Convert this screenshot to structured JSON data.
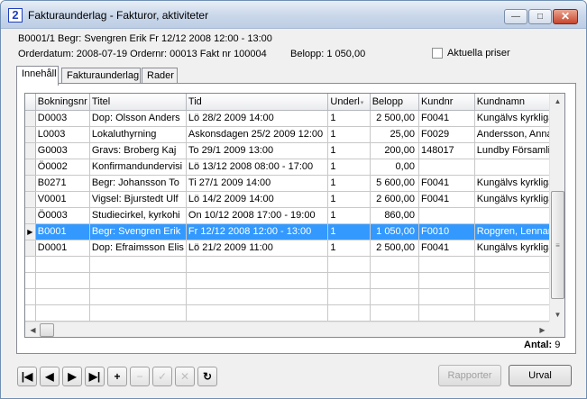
{
  "window": {
    "app_icon": "2",
    "title": "Fakturaunderlag - Fakturor, aktiviteter",
    "controls": {
      "minimize": "—",
      "maximize": "□",
      "close": "✕"
    }
  },
  "info": {
    "line1": "B0001/1  Begr: Svengren Erik  Fr 12/12 2008 12:00 - 13:00",
    "orderdatum": "Orderdatum: 2008-07-19 Ordernr: 00013 Fakt nr 100004",
    "belopp": "Belopp:  1 050,00",
    "aktuella_priser": "Aktuella priser"
  },
  "tabs": [
    {
      "label": "Innehåll"
    },
    {
      "label": "Fakturaunderlag"
    },
    {
      "label": "Rader"
    }
  ],
  "table": {
    "columns": [
      "Bokningsnr",
      "Titel",
      "Tid",
      "Underl",
      "Belopp",
      "Kundnr",
      "Kundnamn"
    ],
    "rows": [
      {
        "bokningsnr": "D0003",
        "titel": "Dop: Olsson Anders",
        "tid": "Lö 28/2 2009 14:00",
        "underl": "1",
        "belopp": "2 500,00",
        "kundnr": "F0041",
        "kundnamn": "Kungälvs kyrkliga s"
      },
      {
        "bokningsnr": "L0003",
        "titel": "Lokaluthyrning",
        "tid": "Askonsdagen 25/2 2009 12:00",
        "underl": "1",
        "belopp": "25,00",
        "kundnr": "F0029",
        "kundnamn": "Andersson, Anna"
      },
      {
        "bokningsnr": "G0003",
        "titel": "Gravs: Broberg Kaj",
        "tid": "To 29/1 2009 13:00",
        "underl": "1",
        "belopp": "200,00",
        "kundnr": "148017",
        "kundnamn": "Lundby Församling"
      },
      {
        "bokningsnr": "Ö0002",
        "titel": "Konfirmandundervisi",
        "tid": "Lö 13/12 2008 08:00 - 17:00",
        "underl": "1",
        "belopp": "0,00",
        "kundnr": "",
        "kundnamn": ""
      },
      {
        "bokningsnr": "B0271",
        "titel": "Begr: Johansson To",
        "tid": "Ti 27/1 2009 14:00",
        "underl": "1",
        "belopp": "5 600,00",
        "kundnr": "F0041",
        "kundnamn": "Kungälvs kyrkliga s"
      },
      {
        "bokningsnr": "V0001",
        "titel": "Vigsel: Bjurstedt Ulf",
        "tid": "Lö 14/2 2009 14:00",
        "underl": "1",
        "belopp": "2 600,00",
        "kundnr": "F0041",
        "kundnamn": "Kungälvs kyrkliga s"
      },
      {
        "bokningsnr": "Ö0003",
        "titel": "Studiecirkel, kyrkohi",
        "tid": "On 10/12 2008 17:00 - 19:00",
        "underl": "1",
        "belopp": "860,00",
        "kundnr": "",
        "kundnamn": ""
      },
      {
        "bokningsnr": "B0001",
        "titel": "Begr: Svengren Erik",
        "tid": "Fr 12/12 2008 12:00 - 13:00",
        "underl": "1",
        "belopp": "1 050,00",
        "kundnr": "F0010",
        "kundnamn": "Ropgren, Lennart"
      },
      {
        "bokningsnr": "D0001",
        "titel": "Dop: Efraimsson Elis",
        "tid": "Lö 21/2 2009 11:00",
        "underl": "1",
        "belopp": "2 500,00",
        "kundnr": "F0041",
        "kundnamn": "Kungälvs kyrkliga s"
      }
    ],
    "selected_row": 7,
    "current_row_marker": "▶"
  },
  "count": {
    "label": "Antal:",
    "value": "9"
  },
  "navigation": {
    "first": "|◀",
    "prev": "◀",
    "next": "▶",
    "last": "▶|",
    "add": "+",
    "delete": "−",
    "confirm": "✓",
    "cancel": "✕",
    "refresh": "↻"
  },
  "buttons": {
    "rapporter": "Rapporter",
    "urval": "Urval"
  },
  "colors": {
    "selection": "#3399ff",
    "title_bar": "#c9d7ea",
    "app_icon": "#1f3fbf"
  }
}
